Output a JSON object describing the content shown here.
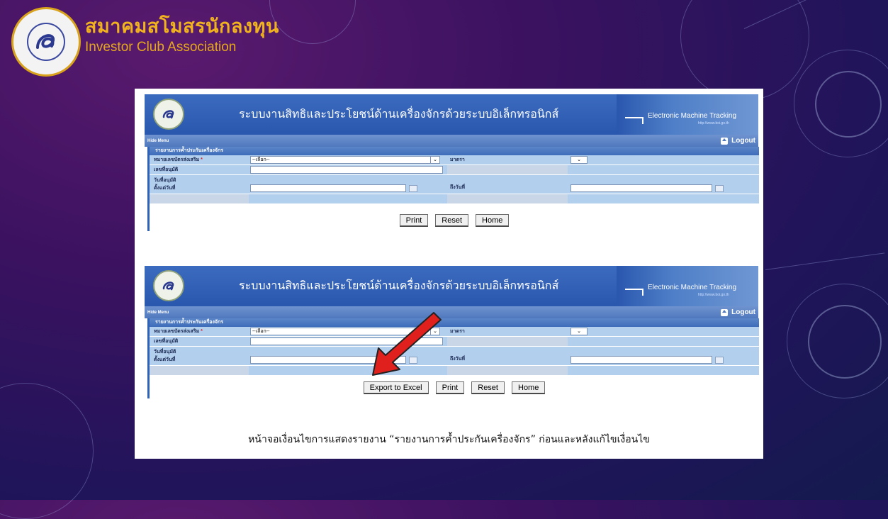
{
  "branding": {
    "name_th": "สมาคมสโมสรนักลงทุน",
    "name_en": "Investor Club Association",
    "accent_color": "#f0b21e"
  },
  "screens": [
    {
      "system_title": "ระบบงานสิทธิและประโยชน์ด้านเครื่องจักรด้วยระบบอิเล็กทรอนิกส์",
      "emt_label": "Electronic Machine Tracking",
      "emt_sub": "http://www.boi.go.th",
      "hide_menu": "Hide Menu",
      "logout": "Logout",
      "section_title": "รายงานการค้ำประกันเครื่องจักร",
      "labels": {
        "promo_cert": "หมายเลขบัตรส่งเสริม",
        "required_mark": "*",
        "section": "มาตรา",
        "approval_no": "เลขที่อนุมัติ",
        "approval_date": "วันที่อนุมัติ",
        "from_date": "ตั้งแต่วันที่",
        "to_date": "ถึงวันที่"
      },
      "select_value": "--เลือก--",
      "buttons": [
        "Print",
        "Reset",
        "Home"
      ]
    },
    {
      "system_title": "ระบบงานสิทธิและประโยชน์ด้านเครื่องจักรด้วยระบบอิเล็กทรอนิกส์",
      "emt_label": "Electronic Machine Tracking",
      "emt_sub": "http://www.boi.go.th",
      "hide_menu": "Hide Menu",
      "logout": "Logout",
      "section_title": "รายงานการค้ำประกันเครื่องจักร",
      "labels": {
        "promo_cert": "หมายเลขบัตรส่งเสริม",
        "required_mark": "*",
        "section": "มาตรา",
        "approval_no": "เลขที่อนุมัติ",
        "approval_date": "วันที่อนุมัติ",
        "from_date": "ตั้งแต่วันที่",
        "to_date": "ถึงวันที่"
      },
      "select_value": "--เลือก--",
      "buttons": [
        "Export to Excel",
        "Print",
        "Reset",
        "Home"
      ]
    }
  ],
  "caption": "หน้าจอเงื่อนไขการแสดงรายงาน “รายงานการค้ำประกันเครื่องจักร” ก่อนและหลังแก้ไขเงื่อนไข",
  "icons": [
    "logo-icon",
    "seal-icon",
    "home-icon",
    "calendar-icon",
    "chevron-down-icon",
    "red-arrow-icon"
  ],
  "colors": {
    "header_blue": "#2a57ae",
    "form_row": "#b3cfee",
    "arrow_red": "#e0201c"
  }
}
